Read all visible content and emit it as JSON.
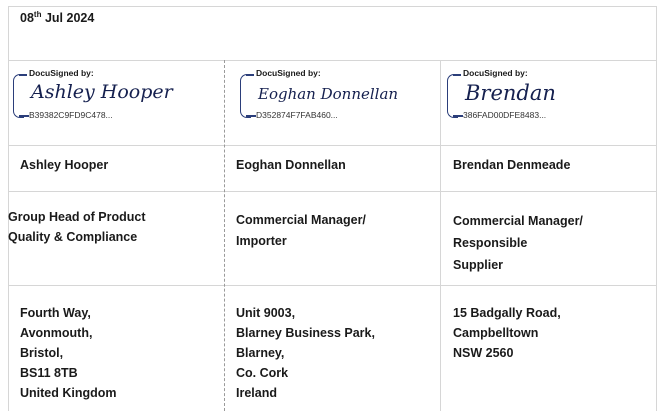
{
  "header": {
    "date_day": "08",
    "date_suffix": "th",
    "date_rest": "Jul 2024"
  },
  "signatures": [
    {
      "label": "DocuSigned by:",
      "script": "Ashley Hooper",
      "id": "B39382C9FD9C478..."
    },
    {
      "label": "DocuSigned by:",
      "script": "Eoghan Donnellan",
      "id": "D352874F7FAB460..."
    },
    {
      "label": "DocuSigned by:",
      "script": "Brendan",
      "id": "386FAD00DFE8483..."
    }
  ],
  "names": [
    "Ashley Hooper",
    "Eoghan Donnellan",
    "Brendan Denmeade"
  ],
  "titles": [
    [
      "Group Head of Product",
      "Quality & Compliance"
    ],
    [
      "Commercial Manager/",
      "Importer"
    ],
    [
      "Commercial Manager/",
      "Responsible",
      "Supplier"
    ]
  ],
  "addresses": [
    [
      "Fourth Way,",
      "Avonmouth,",
      "Bristol,",
      "BS11 8TB",
      "United Kingdom"
    ],
    [
      "Unit 9003,",
      "Blarney Business Park,",
      "Blarney,",
      "Co. Cork",
      "Ireland"
    ],
    [
      "15 Badgally Road,",
      "Campbelltown",
      "NSW 2560"
    ]
  ]
}
